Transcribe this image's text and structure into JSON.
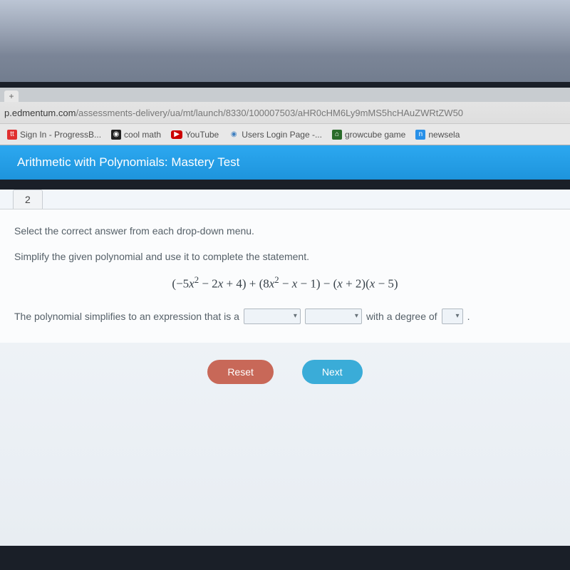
{
  "browser": {
    "new_tab_symbol": "+",
    "url_domain": "p.edmentum.com",
    "url_path": "/assessments-delivery/ua/mt/launch/8330/100007503/aHR0cHM6Ly9mMS5hcHAuZWRtZW50"
  },
  "bookmarks": [
    {
      "label": "Sign In - ProgressB...",
      "icon": "tt"
    },
    {
      "label": "cool math",
      "icon": "◉"
    },
    {
      "label": "YouTube",
      "icon": "▶"
    },
    {
      "label": "Users Login Page -...",
      "icon": "◉"
    },
    {
      "label": "growcube game",
      "icon": "⌂"
    },
    {
      "label": "newsela",
      "icon": "n"
    }
  ],
  "header": {
    "title": "Arithmetic with Polynomials: Mastery Test"
  },
  "question": {
    "number": "2",
    "instruction": "Select the correct answer from each drop-down menu.",
    "sub_instruction": "Simplify the given polynomial and use it to complete the statement.",
    "expression_html": "(−5x² − 2x + 4) + (8x² − x − 1) − (x + 2)(x − 5)",
    "sentence_prefix": "The polynomial simplifies to an expression that is a",
    "sentence_mid": "with a degree of",
    "dropdown_caret": "▾"
  },
  "buttons": {
    "reset": "Reset",
    "next": "Next"
  }
}
